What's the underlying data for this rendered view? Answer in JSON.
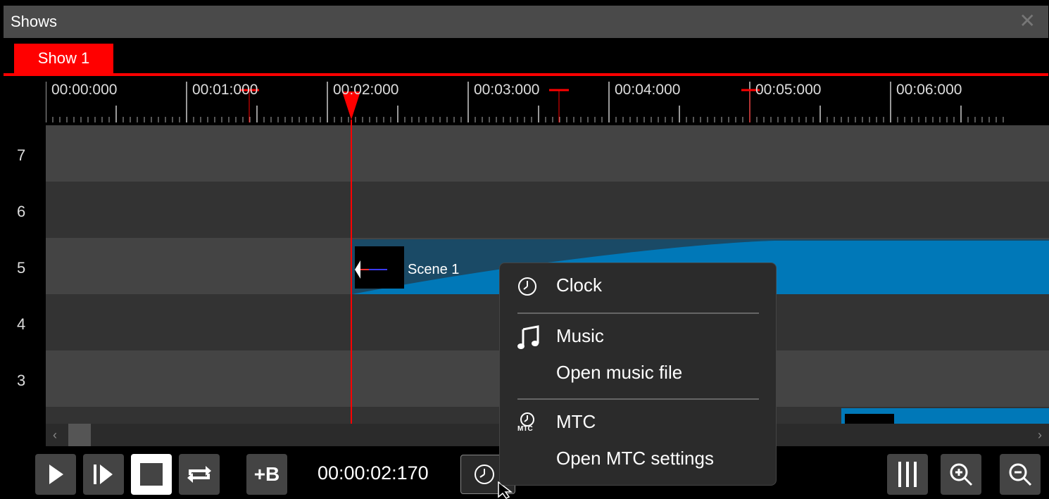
{
  "window": {
    "title": "Shows",
    "close_glyph": "✕"
  },
  "tabs": [
    {
      "label": "Show 1",
      "active": true
    }
  ],
  "ruler": {
    "labels": [
      "00:00:000",
      "00:01:000",
      "00:02:000",
      "00:03:000",
      "00:04:000",
      "00:05:000",
      "00:06:000"
    ]
  },
  "tracks": [
    "7",
    "6",
    "5",
    "4",
    "3"
  ],
  "scene": {
    "label": "Scene 1"
  },
  "transport": {
    "time": "00:00:02:170",
    "bump_label": "+B"
  },
  "menu": {
    "clock": "Clock",
    "music": "Music",
    "open_music": "Open music file",
    "mtc": "MTC",
    "mtc_badge": "MTC",
    "open_mtc": "Open MTC settings"
  },
  "colors": {
    "accent": "#ff0000",
    "scene": "#0078b8",
    "track_light": "#444444",
    "track_dark": "#333333"
  }
}
